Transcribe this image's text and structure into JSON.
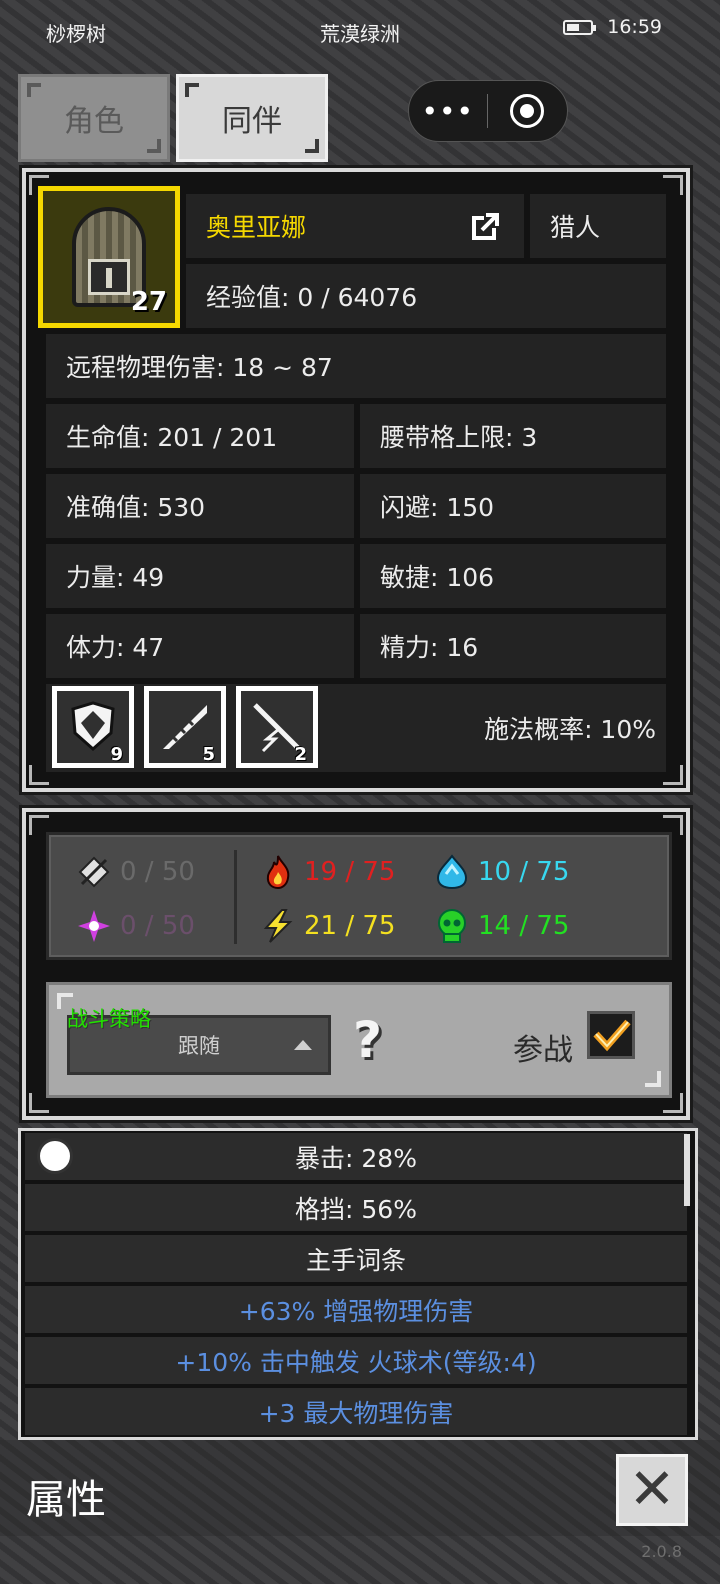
{
  "status_bar": {
    "left_label": "桫椤树",
    "location": "荒漠绿洲",
    "time": "16:59"
  },
  "tabs": [
    {
      "label": "角色",
      "active": false
    },
    {
      "label": "同伴",
      "active": true
    }
  ],
  "mini_program_capsule": {
    "more_icon": "more-dots-icon",
    "close_icon": "target-circle-icon"
  },
  "character": {
    "name": "奥里亚娜",
    "name_color": "#f5d800",
    "level": "27",
    "class": "猎人",
    "exp": "经验值: 0 / 64076",
    "damage": "远程物理伤害: 18 ~ 87",
    "portrait_icon": "knight-helmet-icon",
    "share_icon": "share-export-icon"
  },
  "attributes": [
    {
      "label": "生命值: 201 / 201"
    },
    {
      "label": "腰带格上限: 3"
    },
    {
      "label": "准确值: 530"
    },
    {
      "label": "闪避: 150"
    },
    {
      "label": "力量: 49"
    },
    {
      "label": "敏捷: 106"
    },
    {
      "label": "体力: 47"
    },
    {
      "label": "精力: 16"
    }
  ],
  "skills": [
    {
      "icon": "shield-skill-icon",
      "count": "9"
    },
    {
      "icon": "blade-skill-icon",
      "count": "5"
    },
    {
      "icon": "lightning-staff-skill-icon",
      "count": "2"
    }
  ],
  "cast_chance": "施法概率: 10%",
  "resistances": [
    {
      "icon": "physical-resist-icon",
      "value": "0 / 50",
      "color": "#6a6a6a"
    },
    {
      "icon": "magic-resist-icon",
      "value": "0 / 50",
      "color": "#6b4f6b"
    },
    {
      "icon": "fire-resist-icon",
      "value": "19 / 75",
      "color": "#e02020"
    },
    {
      "icon": "lightning-resist-icon",
      "value": "21 / 75",
      "color": "#f4e020"
    },
    {
      "icon": "cold-resist-icon",
      "value": "10 / 75",
      "color": "#38d8f0"
    },
    {
      "icon": "poison-resist-icon",
      "value": "14 / 75",
      "color": "#22e022"
    }
  ],
  "strategy": {
    "label": "战斗策略",
    "selected": "跟随",
    "help": "?",
    "join_label": "参战",
    "join_checked": true
  },
  "stats_list": [
    {
      "text": "暴击: 28%",
      "type": "normal"
    },
    {
      "text": "格挡: 56%",
      "type": "normal"
    },
    {
      "text": "主手词条",
      "type": "normal"
    },
    {
      "text": "+63% 增强物理伤害",
      "type": "blue"
    },
    {
      "text": "+10% 击中触发 火球术(等级:4)",
      "type": "blue"
    },
    {
      "text": "+3 最大物理伤害",
      "type": "blue"
    }
  ],
  "footer": {
    "title": "属性",
    "close_icon": "close-x-icon",
    "version": "2.0.8"
  }
}
